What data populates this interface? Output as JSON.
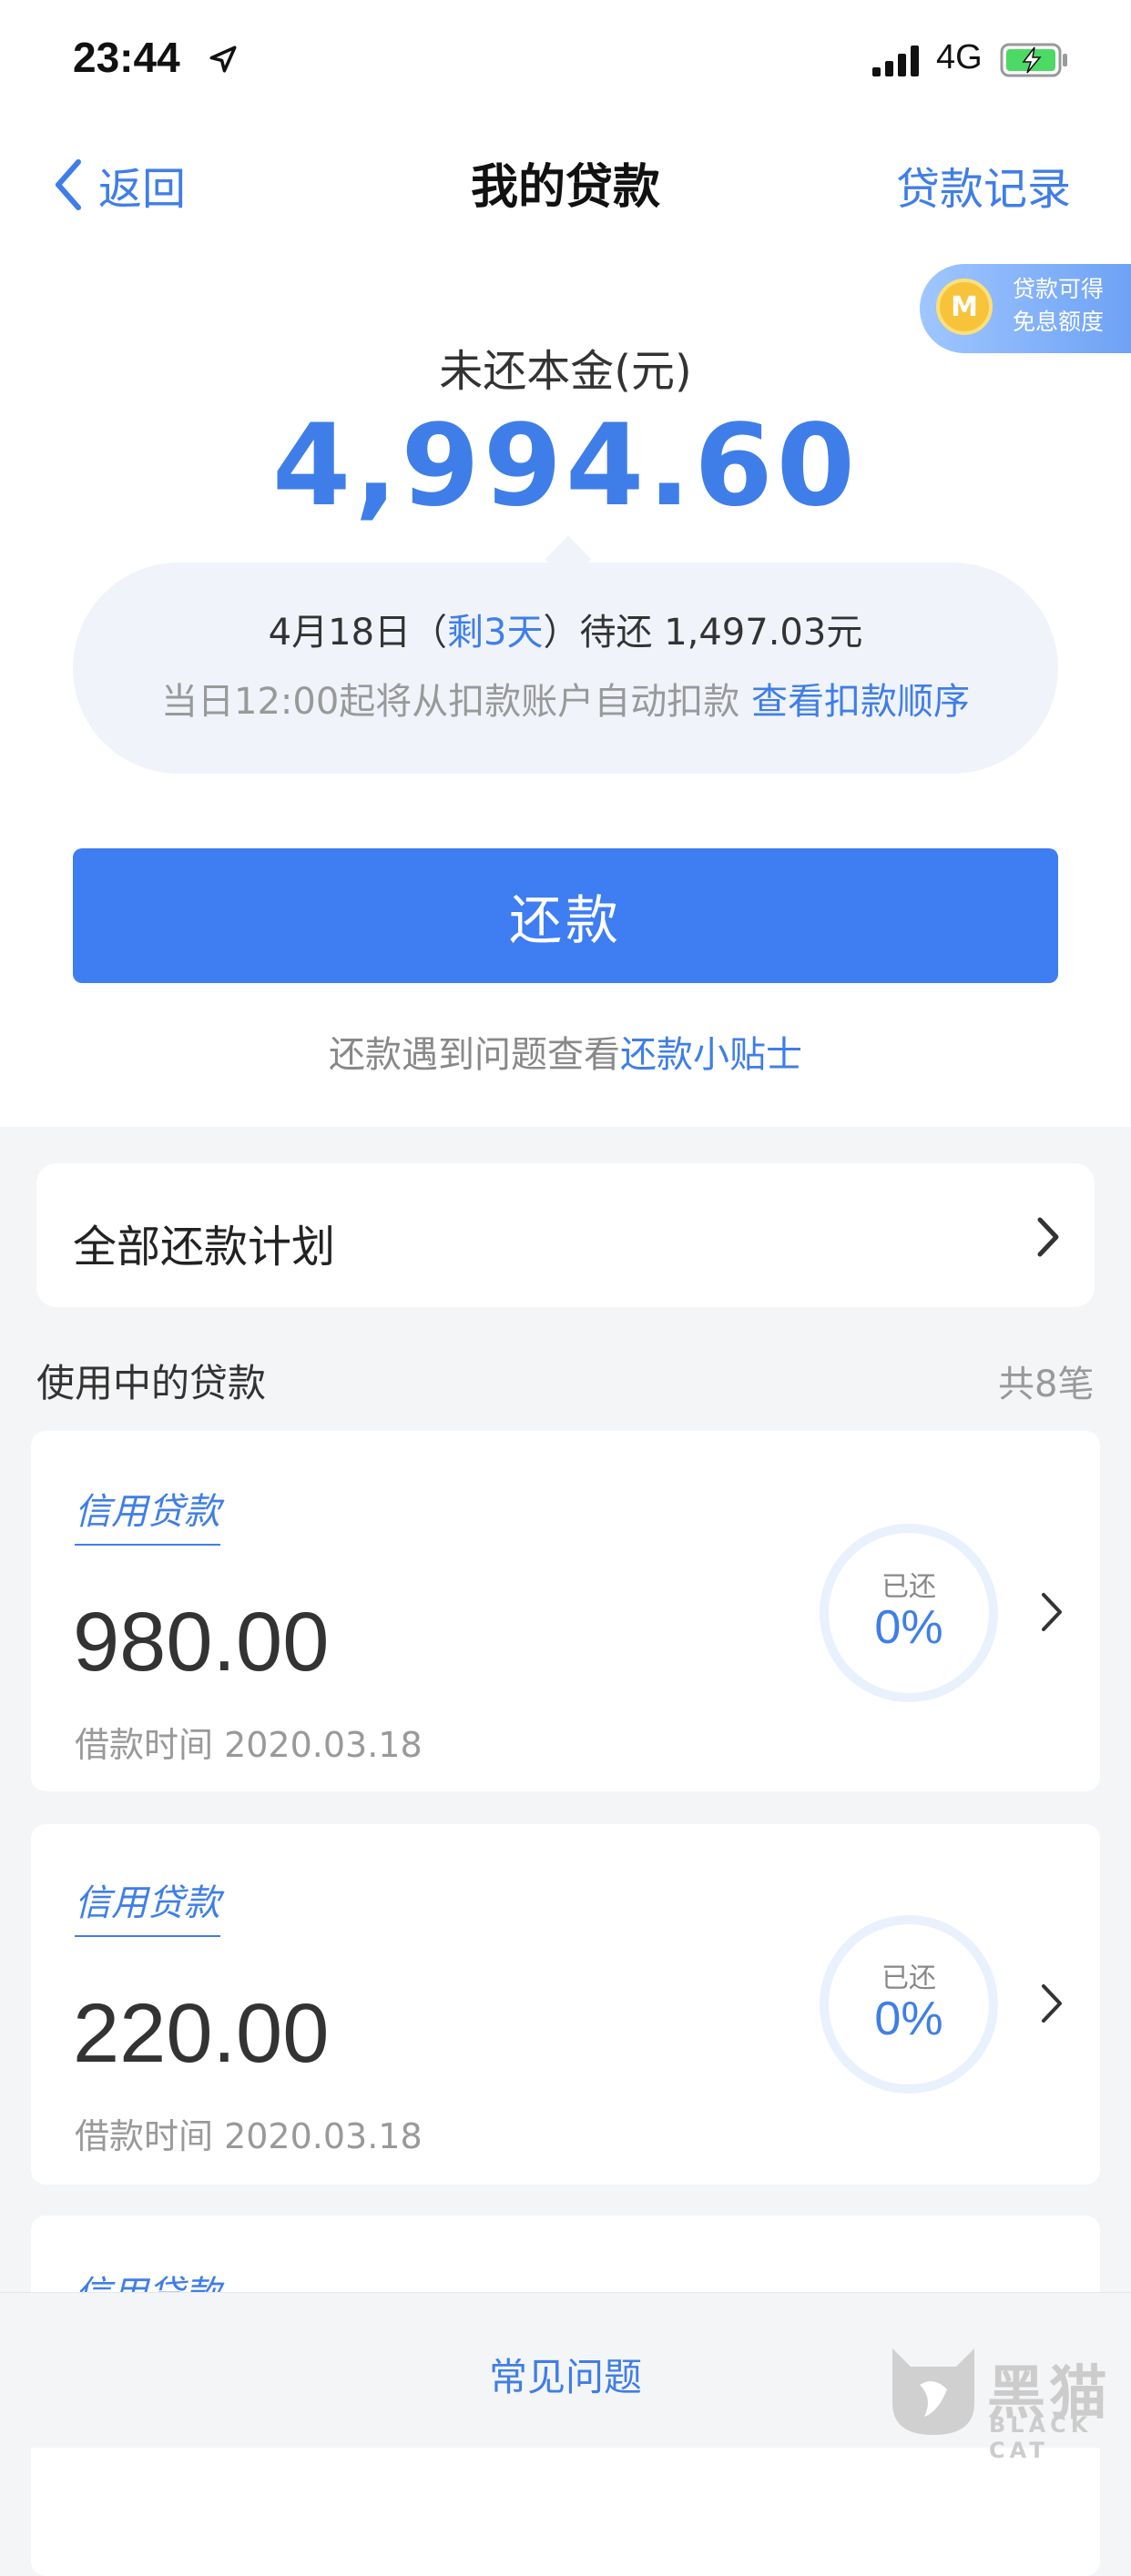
{
  "status_bar": {
    "time": "23:44",
    "network": "4G"
  },
  "nav": {
    "back_label": "返回",
    "title": "我的贷款",
    "records_label": "贷款记录"
  },
  "promo": {
    "line1": "贷款可得",
    "line2": "免息额度",
    "coin_glyph": "M"
  },
  "summary": {
    "principal_label": "未还本金(元)",
    "principal_amount": "4,994.60",
    "due_date": "4月18日（",
    "days_left": "剩3天",
    "due_suffix": "）待还 1,497.03元",
    "auto_text": "当日12:00起将从扣款账户自动扣款 ",
    "auto_link": "查看扣款顺序"
  },
  "repay_button": "还款",
  "tips": {
    "text": "还款遇到问题查看",
    "link": "还款小贴士"
  },
  "plan": {
    "label": "全部还款计划"
  },
  "loans_section": {
    "title": "使用中的贷款",
    "count": "共8笔"
  },
  "loans": [
    {
      "type": "信用贷款",
      "amount": "980.00",
      "date": "借款时间 2020.03.18",
      "repaid_label": "已还",
      "repaid_pct": "0%"
    },
    {
      "type": "信用贷款",
      "amount": "220.00",
      "date": "借款时间 2020.03.18",
      "repaid_label": "已还",
      "repaid_pct": "0%"
    },
    {
      "type": "信用贷款"
    }
  ],
  "bottom_bar": {
    "faq": "常见问题"
  },
  "watermark": {
    "cn": "黑猫",
    "en": "BLACK CAT"
  },
  "colors": {
    "accent": "#3f7ee8",
    "button": "#3e7df2",
    "background": "#f4f5f7"
  }
}
